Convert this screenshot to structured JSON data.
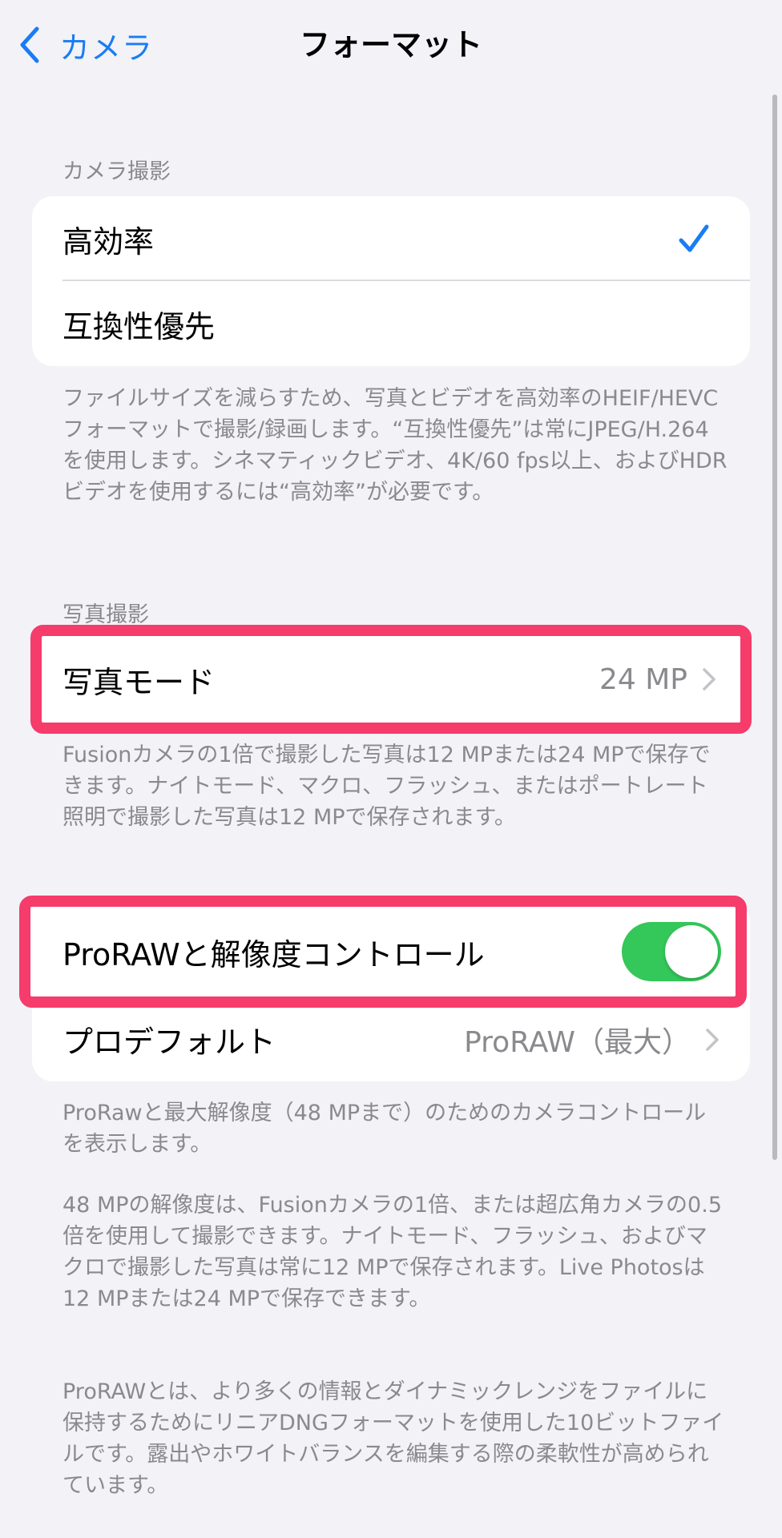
{
  "nav": {
    "back_label": "カメラ",
    "title": "フォーマット"
  },
  "camera_capture": {
    "header": "カメラ撮影",
    "options": [
      {
        "label": "高効率",
        "selected": true
      },
      {
        "label": "互換性優先",
        "selected": false
      }
    ],
    "footer": "ファイルサイズを減らすため、写真とビデオを高効率のHEIF/HEVCフォーマットで撮影/録画します。“互換性優先”は常にJPEG/H.264を使用します。シネマティックビデオ、4K/60 fps以上、およびHDRビデオを使用するには“高効率”が必要です。"
  },
  "photo_capture": {
    "header": "写真撮影",
    "photo_mode": {
      "label": "写真モード",
      "value": "24 MP"
    },
    "footer": "Fusionカメラの1倍で撮影した写真は12 MPまたは24 MPで保存できます。ナイトモード、マクロ、フラッシュ、またはポートレート照明で撮影した写真は12 MPで保存されます。"
  },
  "proraw": {
    "toggle_label": "ProRAWと解像度コントロール",
    "toggle_on": true,
    "default_label": "プロデフォルト",
    "default_value": "ProRAW（最大）",
    "footer_1": "ProRawと最大解像度（48 MPまで）のためのカメラコントロールを表示します。",
    "footer_2": "48 MPの解像度は、Fusionカメラの1倍、または超広角カメラの0.5倍を使用して撮影できます。ナイトモード、フラッシュ、およびマクロで撮影した写真は常に12 MPで保存されます。Live Photosは12 MPまたは24 MPで保存できます。",
    "footer_3": "ProRAWとは、より多くの情報とダイナミックレンジをファイルに保持するためにリニアDNGフォーマットを使用した10ビットファイルです。露出やホワイトバランスを編集する際の柔軟性が高められています。"
  },
  "colors": {
    "accent": "#1a7cf5",
    "highlight": "#f53c6b",
    "toggle_on": "#34c759"
  }
}
